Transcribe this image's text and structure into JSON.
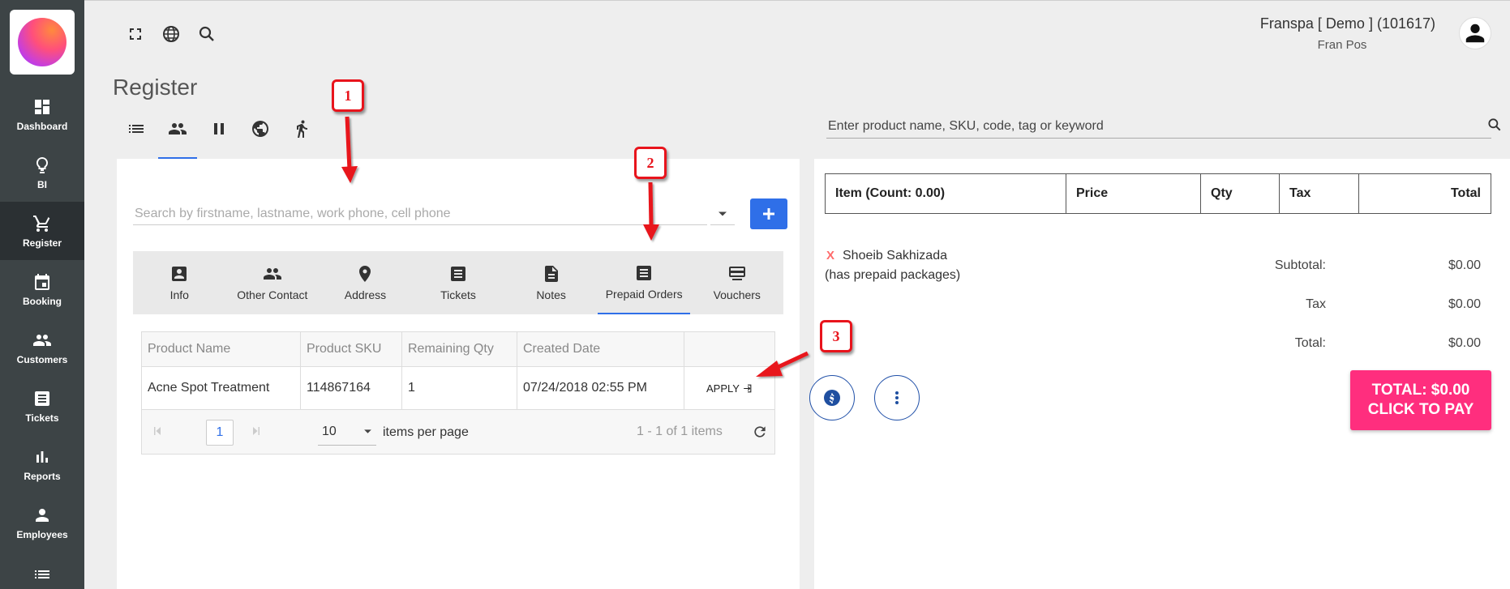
{
  "sidebar": {
    "items": [
      {
        "label": "Dashboard",
        "icon": "dashboard-icon"
      },
      {
        "label": "BI",
        "icon": "lightbulb-icon"
      },
      {
        "label": "Register",
        "icon": "cart-icon",
        "active": true
      },
      {
        "label": "Booking",
        "icon": "calendar-icon"
      },
      {
        "label": "Customers",
        "icon": "people-icon"
      },
      {
        "label": "Tickets",
        "icon": "ticket-icon"
      },
      {
        "label": "Reports",
        "icon": "bar-chart-icon"
      },
      {
        "label": "Employees",
        "icon": "person-icon"
      },
      {
        "label": "",
        "icon": "list-icon"
      }
    ]
  },
  "header": {
    "account_name": "Franspa [ Demo ] (101617)",
    "account_sub": "Fran Pos",
    "icons": [
      "fullscreen-icon",
      "globe-icon",
      "search-icon"
    ]
  },
  "page": {
    "title": "Register",
    "mode_tabs": [
      "list-icon",
      "people-icon",
      "pause-icon",
      "globe-icon",
      "walk-icon"
    ]
  },
  "customer_panel": {
    "search_placeholder": "Search by firstname, lastname, work phone, cell phone",
    "tabs": [
      {
        "label": "Info",
        "icon": "contact-card-icon"
      },
      {
        "label": "Other Contact",
        "icon": "people-icon"
      },
      {
        "label": "Address",
        "icon": "pin-icon"
      },
      {
        "label": "Tickets",
        "icon": "ticket-icon"
      },
      {
        "label": "Notes",
        "icon": "note-icon"
      },
      {
        "label": "Prepaid Orders",
        "icon": "receipt-icon",
        "active": true
      },
      {
        "label": "Vouchers",
        "icon": "card-icon"
      }
    ],
    "table": {
      "headers": [
        "Product Name",
        "Product SKU",
        "Remaining Qty",
        "Created Date",
        ""
      ],
      "rows": [
        [
          "Acne Spot Treatment",
          "114867164",
          "1",
          "07/24/2018 02:55 PM"
        ]
      ],
      "apply_label": "APPLY"
    },
    "pager": {
      "page": "1",
      "page_size": "10",
      "items_per_page": "items per page",
      "range": "1 - 1 of 1 items"
    }
  },
  "product_search": {
    "placeholder": "Enter product name, SKU, code, tag or keyword"
  },
  "cart": {
    "headers": [
      "Item (Count: 0.00)",
      "Price",
      "Qty",
      "Tax",
      "Total"
    ],
    "remove_mark": "X",
    "customer_name": "Shoeib Sakhizada",
    "customer_note": "(has prepaid packages)",
    "summary": [
      {
        "label": "Subtotal:",
        "value": "$0.00"
      },
      {
        "label": "Tax",
        "value": "$0.00"
      },
      {
        "label": "Total:",
        "value": "$0.00"
      }
    ],
    "pay_line1": "TOTAL: $0.00",
    "pay_line2": "CLICK TO PAY"
  },
  "annotations": [
    "1",
    "2",
    "3"
  ],
  "colors": {
    "sidebar": "#3d4446",
    "accent": "#2f6fe8",
    "pay": "#ff2e7e",
    "annotation": "#e8141c"
  }
}
